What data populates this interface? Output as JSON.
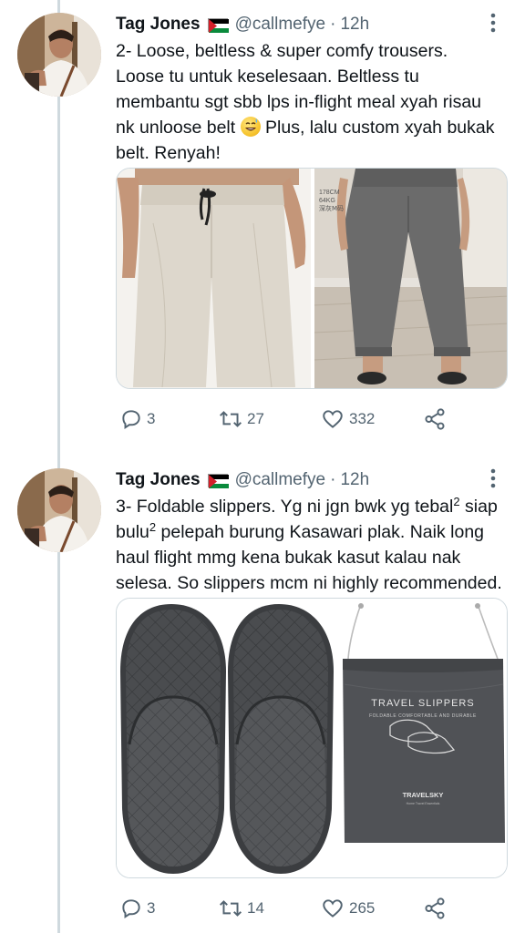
{
  "tweets": [
    {
      "author_name": "Tag Jones",
      "handle": "@callmefye",
      "separator": "·",
      "time": "12h",
      "text_lines": [
        "2- Loose, beltless & super comfy trousers.",
        "Loose tu untuk keselesaan. Beltless tu",
        "membantu sgt sbb lps in-flight meal xyah risau",
        "nk unloose belt",
        " Plus, lalu custom xyah bukak",
        "belt. Renyah!"
      ],
      "media": {
        "image_left_caption": "",
        "image_right_overlay": [
          "178CM",
          "64KG",
          "深灰M码"
        ]
      },
      "replies": "3",
      "retweets": "27",
      "likes": "332"
    },
    {
      "author_name": "Tag Jones",
      "handle": "@callmefye",
      "separator": "·",
      "time": "12h",
      "text_parts": {
        "l1a": "3- Foldable slippers. Yg ni jgn bwk yg tebal",
        "l1sup": "2",
        "l1b": " siap",
        "l2a": "bulu",
        "l2sup": "2",
        "l2b": " pelepah burung Kasawari plak. Naik long",
        "l3": "haul flight mmg kena bukak kasut kalau nak",
        "l4": "selesa. So slippers mcm ni highly recommended."
      },
      "media": {
        "bag_title": "TRAVEL SLIPPERS",
        "bag_subtitle": "FOLDABLE COMFORTABLE AND DURABLE",
        "bag_brand": "TRAVELSKY",
        "bag_brand_sub": "Home Travel Essentials"
      },
      "replies": "3",
      "retweets": "14",
      "likes": "265"
    }
  ],
  "icons": {
    "reply": "reply-icon",
    "retweet": "retweet-icon",
    "like": "heart-icon",
    "share": "share-icon",
    "more": "more-vertical-icon",
    "flag": "palestine-flag-icon",
    "emoji": "grinning-sweat-emoji-icon"
  },
  "colors": {
    "text": "#0f1419",
    "secondary": "#536471",
    "thread_line": "#cfd9de"
  }
}
